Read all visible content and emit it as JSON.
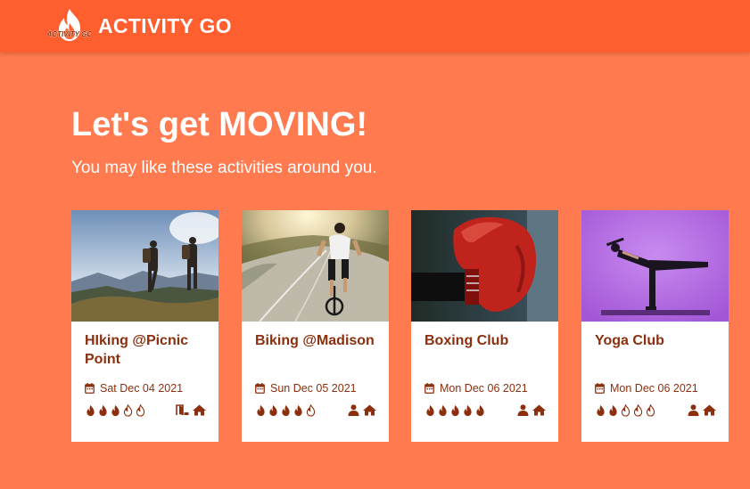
{
  "app": {
    "brand": "ACTIVITY GO",
    "logo_text": "ACTIVITY GO",
    "accent": "#FF5E2E",
    "background": "#FF7A4F",
    "text_color": "#8C2F0E"
  },
  "hero": {
    "title": "Let's get MOVING!",
    "subtitle": "You may like these activities around you."
  },
  "activities": [
    {
      "title": "HIking @Picnic Point",
      "date": "Sat Dec 04 2021",
      "intensity": 3,
      "intensity_max": 5,
      "type_icons": [
        "door-exit-icon",
        "home-icon"
      ],
      "image": "hikers-on-mountain-ridge"
    },
    {
      "title": "Biking @Madison",
      "date": "Sun Dec 05 2021",
      "intensity": 4,
      "intensity_max": 5,
      "type_icons": [
        "person-icon",
        "home-icon"
      ],
      "image": "cyclist-on-road"
    },
    {
      "title": "Boxing Club",
      "date": "Mon Dec 06 2021",
      "intensity": 5,
      "intensity_max": 5,
      "type_icons": [
        "person-icon",
        "home-icon"
      ],
      "image": "red-boxing-glove"
    },
    {
      "title": "Yoga Club",
      "date": "Mon Dec 06 2021",
      "intensity": 2,
      "intensity_max": 5,
      "type_icons": [
        "person-icon",
        "home-icon"
      ],
      "image": "yoga-pose-purple-background"
    }
  ]
}
